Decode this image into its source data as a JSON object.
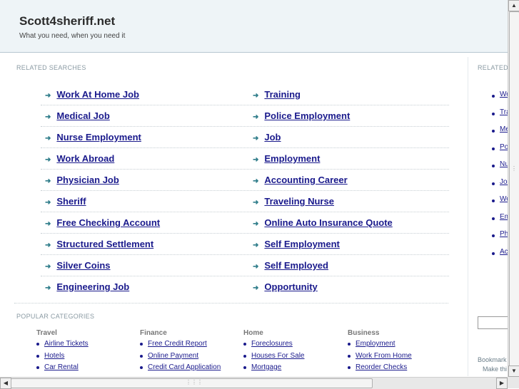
{
  "header": {
    "title": "Scott4sheriff.net",
    "tagline": "What you need, when you need it"
  },
  "related_searches": {
    "heading": "RELATED SEARCHES",
    "left": [
      "Work At Home Job",
      "Medical Job",
      "Nurse Employment",
      "Work Abroad",
      "Physician Job",
      "Sheriff",
      "Free Checking Account",
      "Structured Settlement",
      "Silver Coins",
      "Engineering Job"
    ],
    "right": [
      "Training",
      "Police Employment",
      "Job",
      "Employment",
      "Accounting Career",
      "Traveling Nurse",
      "Online Auto Insurance Quote",
      "Self Employment",
      "Self Employed",
      "Opportunity"
    ]
  },
  "popular_categories": {
    "heading": "POPULAR CATEGORIES",
    "columns": [
      {
        "title": "Travel",
        "links": [
          "Airline Tickets",
          "Hotels",
          "Car Rental"
        ]
      },
      {
        "title": "Finance",
        "links": [
          "Free Credit Report",
          "Online Payment",
          "Credit Card Application"
        ]
      },
      {
        "title": "Home",
        "links": [
          "Foreclosures",
          "Houses For Sale",
          "Mortgage"
        ]
      },
      {
        "title": "Business",
        "links": [
          "Employment",
          "Work From Home",
          "Reorder Checks"
        ]
      }
    ]
  },
  "right_panel": {
    "heading": "RELATED",
    "items": [
      "Wo",
      "Tra",
      "Me",
      "Po",
      "Nu",
      "Jol",
      "Wo",
      "Em",
      "Ph",
      "Acc"
    ],
    "footer_1": "Bookmark",
    "footer_2": "Make thi"
  },
  "icons": {
    "list_arrow": "arrow-right-icon",
    "scroll_up": "triangle-up-icon",
    "scroll_down": "triangle-down-icon",
    "scroll_left": "triangle-left-icon",
    "scroll_right": "triangle-right-icon"
  },
  "colors": {
    "link": "#1a1a8c",
    "header_bg": "#eef4f7",
    "arrow": "#2f7d8a"
  }
}
